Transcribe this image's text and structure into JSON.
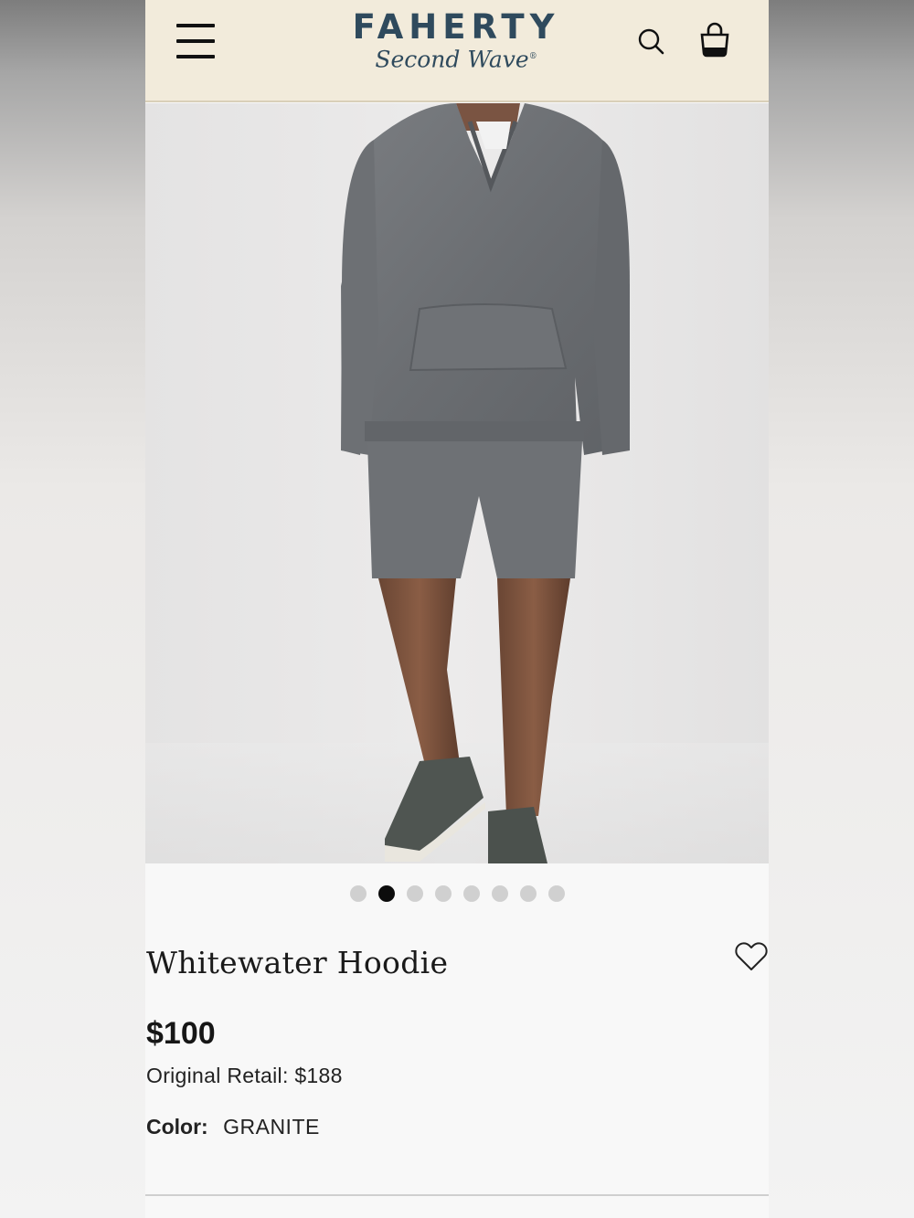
{
  "header": {
    "brand_main": "FAHERTY",
    "brand_sub": "Second Wave",
    "brand_mark": "®",
    "icons": [
      "menu-icon",
      "search-icon",
      "shopping-bag-icon"
    ]
  },
  "carousel": {
    "count": 8,
    "active_index": 1
  },
  "product": {
    "title": "Whitewater Hoodie",
    "price": "$100",
    "original_retail_label": "Original Retail:",
    "original_retail_value": "$188",
    "color_label": "Color:",
    "color_value": "GRANITE"
  },
  "colors": {
    "header_bg": "#f2ebdb",
    "brand": "#2f4a5d",
    "text": "#1a1a1a",
    "dot_active": "#0c0c0c",
    "dot_inactive": "#d0d0d0"
  }
}
